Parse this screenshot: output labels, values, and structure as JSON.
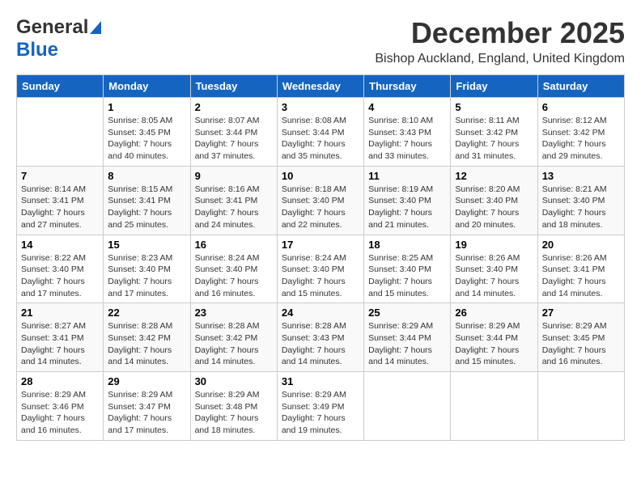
{
  "header": {
    "logo_line1": "General",
    "logo_line2": "Blue",
    "month": "December 2025",
    "location": "Bishop Auckland, England, United Kingdom"
  },
  "days_of_week": [
    "Sunday",
    "Monday",
    "Tuesday",
    "Wednesday",
    "Thursday",
    "Friday",
    "Saturday"
  ],
  "weeks": [
    [
      {
        "day": "",
        "info": ""
      },
      {
        "day": "1",
        "info": "Sunrise: 8:05 AM\nSunset: 3:45 PM\nDaylight: 7 hours\nand 40 minutes."
      },
      {
        "day": "2",
        "info": "Sunrise: 8:07 AM\nSunset: 3:44 PM\nDaylight: 7 hours\nand 37 minutes."
      },
      {
        "day": "3",
        "info": "Sunrise: 8:08 AM\nSunset: 3:44 PM\nDaylight: 7 hours\nand 35 minutes."
      },
      {
        "day": "4",
        "info": "Sunrise: 8:10 AM\nSunset: 3:43 PM\nDaylight: 7 hours\nand 33 minutes."
      },
      {
        "day": "5",
        "info": "Sunrise: 8:11 AM\nSunset: 3:42 PM\nDaylight: 7 hours\nand 31 minutes."
      },
      {
        "day": "6",
        "info": "Sunrise: 8:12 AM\nSunset: 3:42 PM\nDaylight: 7 hours\nand 29 minutes."
      }
    ],
    [
      {
        "day": "7",
        "info": "Sunrise: 8:14 AM\nSunset: 3:41 PM\nDaylight: 7 hours\nand 27 minutes."
      },
      {
        "day": "8",
        "info": "Sunrise: 8:15 AM\nSunset: 3:41 PM\nDaylight: 7 hours\nand 25 minutes."
      },
      {
        "day": "9",
        "info": "Sunrise: 8:16 AM\nSunset: 3:41 PM\nDaylight: 7 hours\nand 24 minutes."
      },
      {
        "day": "10",
        "info": "Sunrise: 8:18 AM\nSunset: 3:40 PM\nDaylight: 7 hours\nand 22 minutes."
      },
      {
        "day": "11",
        "info": "Sunrise: 8:19 AM\nSunset: 3:40 PM\nDaylight: 7 hours\nand 21 minutes."
      },
      {
        "day": "12",
        "info": "Sunrise: 8:20 AM\nSunset: 3:40 PM\nDaylight: 7 hours\nand 20 minutes."
      },
      {
        "day": "13",
        "info": "Sunrise: 8:21 AM\nSunset: 3:40 PM\nDaylight: 7 hours\nand 18 minutes."
      }
    ],
    [
      {
        "day": "14",
        "info": "Sunrise: 8:22 AM\nSunset: 3:40 PM\nDaylight: 7 hours\nand 17 minutes."
      },
      {
        "day": "15",
        "info": "Sunrise: 8:23 AM\nSunset: 3:40 PM\nDaylight: 7 hours\nand 17 minutes."
      },
      {
        "day": "16",
        "info": "Sunrise: 8:24 AM\nSunset: 3:40 PM\nDaylight: 7 hours\nand 16 minutes."
      },
      {
        "day": "17",
        "info": "Sunrise: 8:24 AM\nSunset: 3:40 PM\nDaylight: 7 hours\nand 15 minutes."
      },
      {
        "day": "18",
        "info": "Sunrise: 8:25 AM\nSunset: 3:40 PM\nDaylight: 7 hours\nand 15 minutes."
      },
      {
        "day": "19",
        "info": "Sunrise: 8:26 AM\nSunset: 3:40 PM\nDaylight: 7 hours\nand 14 minutes."
      },
      {
        "day": "20",
        "info": "Sunrise: 8:26 AM\nSunset: 3:41 PM\nDaylight: 7 hours\nand 14 minutes."
      }
    ],
    [
      {
        "day": "21",
        "info": "Sunrise: 8:27 AM\nSunset: 3:41 PM\nDaylight: 7 hours\nand 14 minutes."
      },
      {
        "day": "22",
        "info": "Sunrise: 8:28 AM\nSunset: 3:42 PM\nDaylight: 7 hours\nand 14 minutes."
      },
      {
        "day": "23",
        "info": "Sunrise: 8:28 AM\nSunset: 3:42 PM\nDaylight: 7 hours\nand 14 minutes."
      },
      {
        "day": "24",
        "info": "Sunrise: 8:28 AM\nSunset: 3:43 PM\nDaylight: 7 hours\nand 14 minutes."
      },
      {
        "day": "25",
        "info": "Sunrise: 8:29 AM\nSunset: 3:44 PM\nDaylight: 7 hours\nand 14 minutes."
      },
      {
        "day": "26",
        "info": "Sunrise: 8:29 AM\nSunset: 3:44 PM\nDaylight: 7 hours\nand 15 minutes."
      },
      {
        "day": "27",
        "info": "Sunrise: 8:29 AM\nSunset: 3:45 PM\nDaylight: 7 hours\nand 16 minutes."
      }
    ],
    [
      {
        "day": "28",
        "info": "Sunrise: 8:29 AM\nSunset: 3:46 PM\nDaylight: 7 hours\nand 16 minutes."
      },
      {
        "day": "29",
        "info": "Sunrise: 8:29 AM\nSunset: 3:47 PM\nDaylight: 7 hours\nand 17 minutes."
      },
      {
        "day": "30",
        "info": "Sunrise: 8:29 AM\nSunset: 3:48 PM\nDaylight: 7 hours\nand 18 minutes."
      },
      {
        "day": "31",
        "info": "Sunrise: 8:29 AM\nSunset: 3:49 PM\nDaylight: 7 hours\nand 19 minutes."
      },
      {
        "day": "",
        "info": ""
      },
      {
        "day": "",
        "info": ""
      },
      {
        "day": "",
        "info": ""
      }
    ]
  ]
}
